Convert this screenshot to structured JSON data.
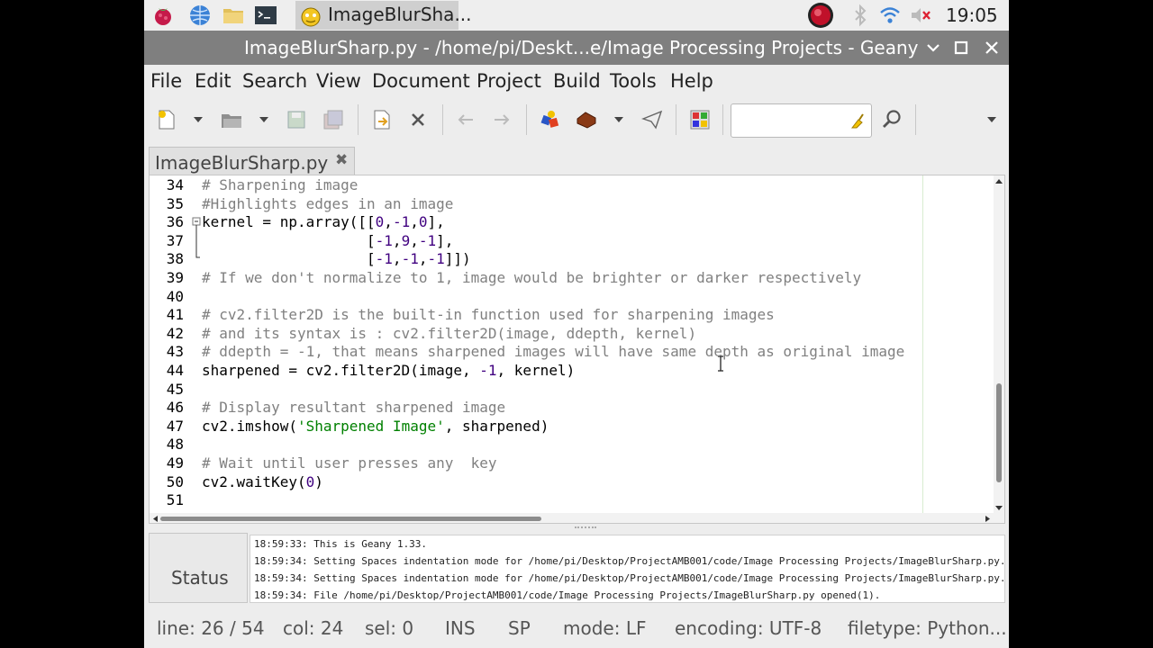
{
  "panel": {
    "task_label": "ImageBlurSha...",
    "clock": "19:05",
    "icons": [
      "raspberry-icon",
      "globe-icon",
      "folder-icon",
      "terminal-icon",
      "geany-icon",
      "record-icon",
      "bluetooth-icon",
      "wifi-icon",
      "volume-muted-icon"
    ]
  },
  "window": {
    "title": "ImageBlurSharp.py - /home/pi/Deskt...e/Image Processing Projects - Geany",
    "minimize": "⌄",
    "maximize": "□",
    "close": "✕"
  },
  "menu": [
    "File",
    "Edit",
    "Search",
    "View",
    "Document",
    "Project",
    "Build",
    "Tools",
    "Help"
  ],
  "tab": {
    "label": "ImageBlurSharp.py",
    "close": "✖"
  },
  "editor": {
    "lines": [
      {
        "n": "34",
        "parts": [
          {
            "t": "# Sharpening image",
            "c": "cm"
          }
        ]
      },
      {
        "n": "35",
        "parts": [
          {
            "t": "#Highlights edges in an image",
            "c": "cm"
          }
        ]
      },
      {
        "n": "36",
        "parts": [
          {
            "t": "kernel = np.array([[",
            "c": "lb"
          },
          {
            "t": "0",
            "c": "nm"
          },
          {
            "t": ",",
            "c": "lb"
          },
          {
            "t": "-1",
            "c": "nm"
          },
          {
            "t": ",",
            "c": "lb"
          },
          {
            "t": "0",
            "c": "nm"
          },
          {
            "t": "],",
            "c": "lb"
          }
        ]
      },
      {
        "n": "37",
        "parts": [
          {
            "t": "                   [",
            "c": "lb"
          },
          {
            "t": "-1",
            "c": "nm"
          },
          {
            "t": ",",
            "c": "lb"
          },
          {
            "t": "9",
            "c": "nm"
          },
          {
            "t": ",",
            "c": "lb"
          },
          {
            "t": "-1",
            "c": "nm"
          },
          {
            "t": "],",
            "c": "lb"
          }
        ]
      },
      {
        "n": "38",
        "parts": [
          {
            "t": "                   [",
            "c": "lb"
          },
          {
            "t": "-1",
            "c": "nm"
          },
          {
            "t": ",",
            "c": "lb"
          },
          {
            "t": "-1",
            "c": "nm"
          },
          {
            "t": ",",
            "c": "lb"
          },
          {
            "t": "-1",
            "c": "nm"
          },
          {
            "t": "]])",
            "c": "lb"
          }
        ]
      },
      {
        "n": "39",
        "parts": [
          {
            "t": "# If we don't normalize to 1, image would be brighter or darker respectively",
            "c": "cm"
          }
        ]
      },
      {
        "n": "40",
        "parts": []
      },
      {
        "n": "41",
        "parts": [
          {
            "t": "# cv2.filter2D is the built-in function used for sharpening images",
            "c": "cm"
          }
        ]
      },
      {
        "n": "42",
        "parts": [
          {
            "t": "# and its syntax is : cv2.filter2D(image, ddepth, kernel)",
            "c": "cm"
          }
        ]
      },
      {
        "n": "43",
        "parts": [
          {
            "t": "# ddepth = -1, that means sharpened images will have same depth as original image",
            "c": "cm"
          }
        ]
      },
      {
        "n": "44",
        "parts": [
          {
            "t": "sharpened = cv2.filter2D(image, ",
            "c": "lb"
          },
          {
            "t": "-1",
            "c": "nm"
          },
          {
            "t": ", kernel)",
            "c": "lb"
          }
        ]
      },
      {
        "n": "45",
        "parts": []
      },
      {
        "n": "46",
        "parts": [
          {
            "t": "# Display resultant sharpened image",
            "c": "cm"
          }
        ]
      },
      {
        "n": "47",
        "parts": [
          {
            "t": "cv2.imshow(",
            "c": "lb"
          },
          {
            "t": "'Sharpened Image'",
            "c": "st"
          },
          {
            "t": ", sharpened)",
            "c": "lb"
          }
        ]
      },
      {
        "n": "48",
        "parts": []
      },
      {
        "n": "49",
        "parts": [
          {
            "t": "# Wait until user presses any  key",
            "c": "cm"
          }
        ]
      },
      {
        "n": "50",
        "parts": [
          {
            "t": "cv2.waitKey(",
            "c": "lb"
          },
          {
            "t": "0",
            "c": "nm"
          },
          {
            "t": ")",
            "c": "lb"
          }
        ]
      },
      {
        "n": "51",
        "parts": []
      }
    ]
  },
  "messages": {
    "status_label": "Status",
    "lines": [
      "18:59:33: This is Geany 1.33.",
      "18:59:34: Setting Spaces indentation mode for /home/pi/Desktop/ProjectAMB001/code/Image Processing Projects/ImageBlurSharp.py.",
      "18:59:34: Setting Spaces indentation mode for /home/pi/Desktop/ProjectAMB001/code/Image Processing Projects/ImageBlurSharp.py.",
      "18:59:34: File /home/pi/Desktop/ProjectAMB001/code/Image Processing Projects/ImageBlurSharp.py opened(1)."
    ]
  },
  "statusbar": {
    "line": "line: 26 / 54",
    "col": "col: 24",
    "sel": "sel: 0",
    "ins": "INS",
    "sp": "SP",
    "mode": "mode: LF",
    "encoding": "encoding: UTF-8",
    "filetype": "filetype: Python..."
  }
}
